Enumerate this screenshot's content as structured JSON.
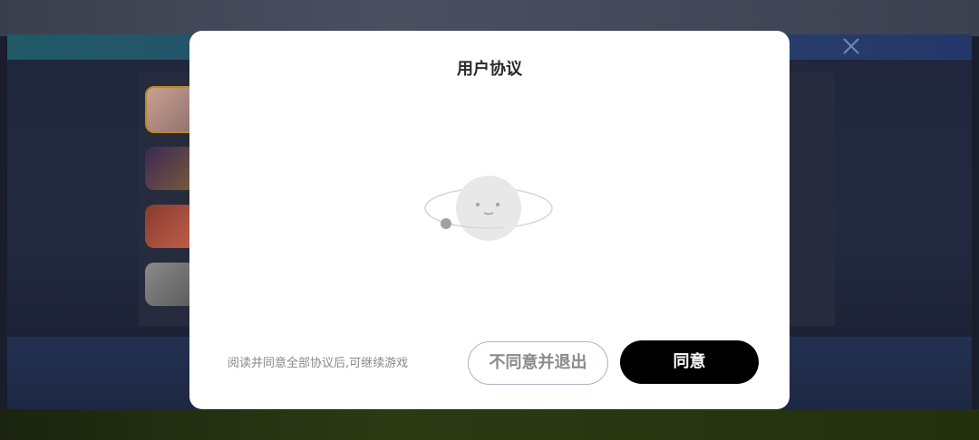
{
  "modal": {
    "title": "用户协议",
    "footer_text": "阅读并同意全部协议后,可继续游戏",
    "decline_label": "不同意并退出",
    "agree_label": "同意"
  },
  "background": {
    "close_icon": "close-icon"
  },
  "colors": {
    "modal_bg": "#ffffff",
    "agree_bg": "#000000",
    "decline_border": "#aab4c4"
  }
}
